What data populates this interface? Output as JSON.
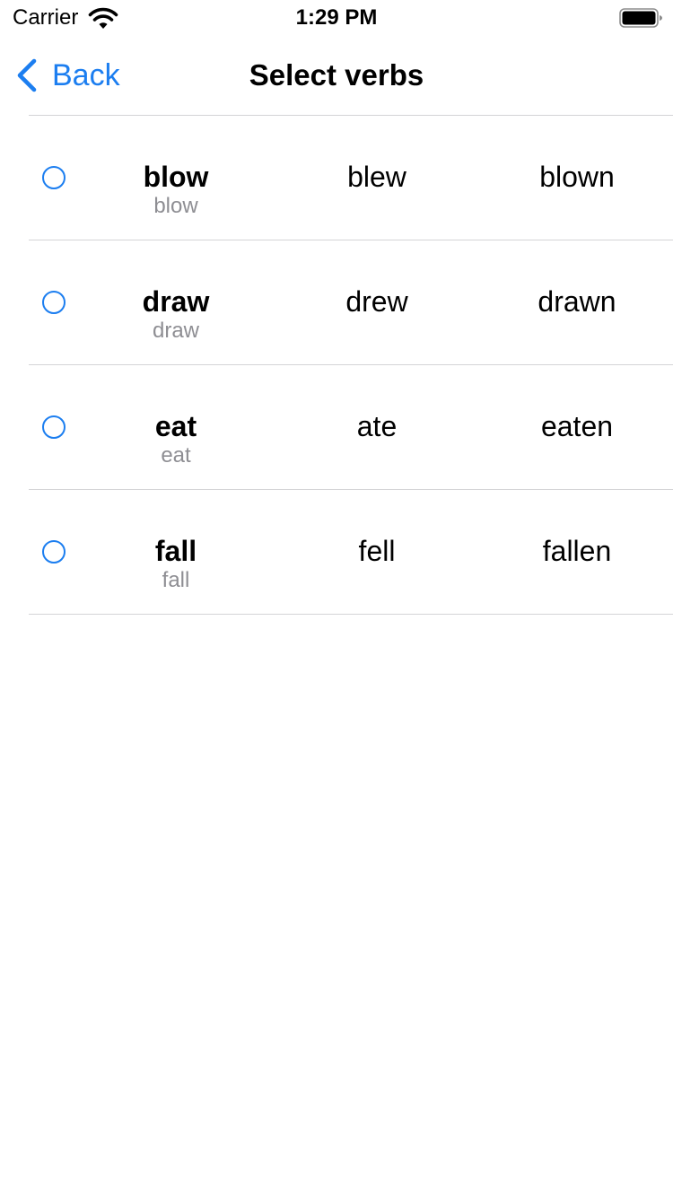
{
  "status_bar": {
    "carrier": "Carrier",
    "time": "1:29 PM",
    "wifi_icon": "wifi-icon",
    "battery_icon": "battery-icon"
  },
  "nav": {
    "back_label": "Back",
    "back_icon": "chevron-left-icon",
    "title": "Select verbs"
  },
  "colors": {
    "accent": "#1c7ef0",
    "secondary_text": "#8e8e93",
    "separator": "#d4d4d6"
  },
  "verbs": [
    {
      "base": "blow",
      "base_sub": "blow",
      "past": "blew",
      "participle": "blown",
      "selected": false
    },
    {
      "base": "draw",
      "base_sub": "draw",
      "past": "drew",
      "participle": "drawn",
      "selected": false
    },
    {
      "base": "eat",
      "base_sub": "eat",
      "past": "ate",
      "participle": "eaten",
      "selected": false
    },
    {
      "base": "fall",
      "base_sub": "fall",
      "past": "fell",
      "participle": "fallen",
      "selected": false
    }
  ]
}
